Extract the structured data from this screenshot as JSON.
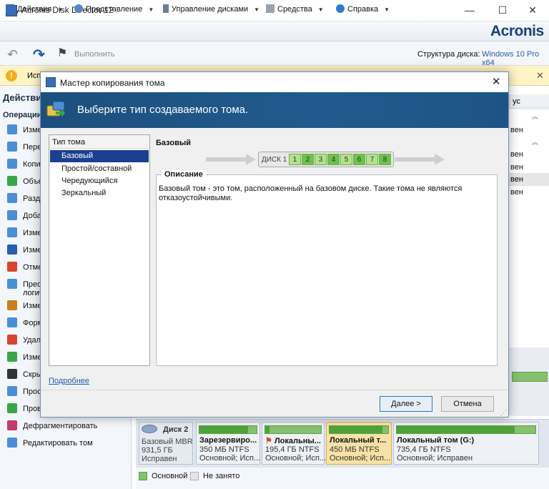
{
  "app": {
    "title": "Acronis Disk Director 12",
    "brand": "Acronis"
  },
  "window_controls": {
    "minimize": "—",
    "maximize": "☐",
    "close": "✕"
  },
  "menu": [
    {
      "label": "Действия",
      "icon": "actions-icon"
    },
    {
      "label": "Представление",
      "icon": "view-icon"
    },
    {
      "label": "Управление дисками",
      "icon": "disk-manage-icon"
    },
    {
      "label": "Средства",
      "icon": "tools-icon"
    },
    {
      "label": "Справка",
      "icon": "help-icon"
    }
  ],
  "toolbar": {
    "execute_label": "Выполнить",
    "disk_structure_label": "Структура диска:",
    "disk_structure_value": "Windows 10 Pro x64"
  },
  "notification": {
    "text": "Исп"
  },
  "left_pane": {
    "header": "Действия",
    "operations_header": "Операции",
    "operations": [
      {
        "label": "Изме",
        "icon": "resize-icon",
        "color": "#4a8fd6"
      },
      {
        "label": "Пере",
        "icon": "move-icon",
        "color": "#4a8fd6"
      },
      {
        "label": "Копир",
        "icon": "copy-icon",
        "color": "#4a8fd6"
      },
      {
        "label": "Объе",
        "icon": "merge-icon",
        "color": "#3aa64a"
      },
      {
        "label": "Разде",
        "icon": "split-icon",
        "color": "#4a8fd6"
      },
      {
        "label": "Доба",
        "icon": "add-icon",
        "color": "#4a8fd6"
      },
      {
        "label": "Измен",
        "icon": "change-icon",
        "color": "#4a8fd6"
      },
      {
        "label": "Измен",
        "icon": "letter-icon",
        "color": "#2a5db0"
      },
      {
        "label": "Отме",
        "icon": "mark-icon",
        "color": "#d9442e"
      },
      {
        "label": "Преоб",
        "label2": "логич",
        "icon": "convert-icon",
        "color": "#4a8fd6"
      },
      {
        "label": "Измен",
        "icon": "label-icon",
        "color": "#c9801e"
      },
      {
        "label": "Форм",
        "icon": "format-icon",
        "color": "#4a8fd6"
      },
      {
        "label": "Удал",
        "icon": "delete-icon",
        "color": "#d9442e"
      },
      {
        "label": "Измен",
        "icon": "cluster-icon",
        "color": "#3aa64a"
      },
      {
        "label": "Скры",
        "icon": "hide-icon",
        "color": "#333333"
      },
      {
        "label": "Прос",
        "icon": "browse-icon",
        "color": "#4a8fd6"
      },
      {
        "label": "Прове",
        "icon": "check-icon",
        "color": "#3aa64a"
      },
      {
        "label": "Дефрагментировать",
        "icon": "defrag-icon",
        "color": "#c23b6a"
      },
      {
        "label": "Редактировать том",
        "icon": "edit-icon",
        "color": "#4a8fd6"
      }
    ]
  },
  "background_list": {
    "column_header": "ус",
    "cells": [
      "вен",
      "вен",
      "вен",
      "вен",
      "вен"
    ]
  },
  "disk_map": {
    "disk": {
      "name": "Диск 2",
      "type": "Базовый MBR",
      "size": "931,5 ГБ",
      "status": "Исправен"
    },
    "partitions": [
      {
        "name": "Зарезервиро...",
        "size": "350 МБ NTFS",
        "status": "Основной; Исп...",
        "used": 0.85
      },
      {
        "name": "Локальны...",
        "size": "195,4 ГБ NTFS",
        "status": "Основной; Исп...",
        "used": 0.08
      },
      {
        "name": "Локальный т...",
        "size": "450 МБ NTFS",
        "status": "Основной; Исп...",
        "used": 0.9
      },
      {
        "name": "Локальный том (G:)",
        "size": "735,4 ГБ NTFS",
        "status": "Основной; Исправен",
        "used": 0.85
      }
    ],
    "legend": {
      "primary": "Основной",
      "free": "Не занято"
    }
  },
  "dialog": {
    "title": "Мастер копирования тома",
    "banner": "Выберите тип создаваемого тома.",
    "volume_type_header": "Тип тома",
    "volume_types": [
      "Базовый",
      "Простой/составной",
      "Чередующийся",
      "Зеркальный"
    ],
    "selected_index": 0,
    "selected_heading": "Базовый",
    "disk_strip": {
      "label": "ДИСК 1",
      "cells": [
        "1",
        "2",
        "3",
        "4",
        "5",
        "6",
        "7",
        "8"
      ]
    },
    "description_title": "Описание",
    "description_text": "Базовый том - это том, расположенный на базовом диске. Такие тома не являются отказоустойчивыми.",
    "more_link": "Подробнее",
    "next_button": "Далее >",
    "cancel_button": "Отмена"
  }
}
